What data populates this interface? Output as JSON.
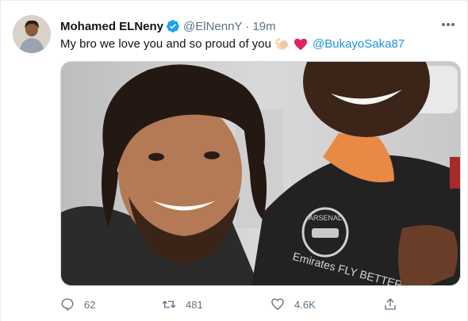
{
  "tweet": {
    "author_name": "Mohamed ELNeny",
    "handle": "@ElNennY",
    "separator": "·",
    "time": "19m",
    "text": "My bro we love you and so proud of you",
    "mention": "@BukayoSaka87",
    "emojis": [
      "clapping-hands-icon",
      "heart-icon"
    ],
    "colors": {
      "accent": "#1b95e0",
      "secondary": "#5b7083",
      "heart": "#e0245e",
      "verified": "#1da1f2"
    }
  },
  "actions": {
    "reply_count": "62",
    "retweet_count": "481",
    "like_count": "4.6K"
  },
  "photo": {
    "jacket_logo_text": "ARSENAL",
    "sponsor_text": "Emirates FLY BETTER"
  }
}
